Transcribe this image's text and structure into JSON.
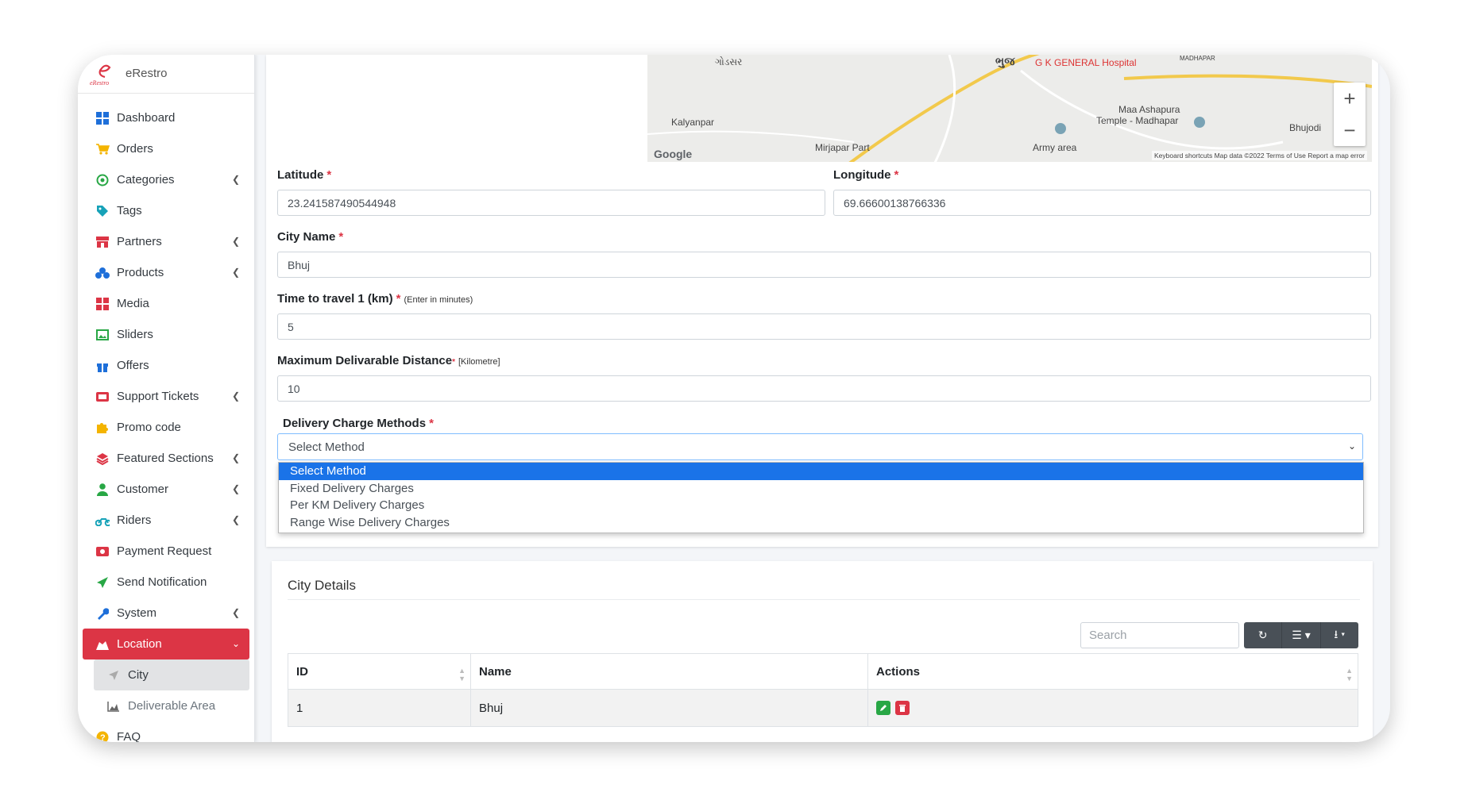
{
  "brand": {
    "name": "eRestro",
    "logo_text": "eRestro"
  },
  "sidebar": {
    "items": [
      {
        "label": "Dashboard",
        "icon": "dashboard-icon",
        "chevron": false
      },
      {
        "label": "Orders",
        "icon": "cart-icon",
        "chevron": false
      },
      {
        "label": "Categories",
        "icon": "categories-icon",
        "chevron": true
      },
      {
        "label": "Tags",
        "icon": "tag-icon",
        "chevron": false
      },
      {
        "label": "Partners",
        "icon": "store-icon",
        "chevron": true
      },
      {
        "label": "Products",
        "icon": "products-icon",
        "chevron": true
      },
      {
        "label": "Media",
        "icon": "media-icon",
        "chevron": false
      },
      {
        "label": "Sliders",
        "icon": "slider-icon",
        "chevron": false
      },
      {
        "label": "Offers",
        "icon": "gift-icon",
        "chevron": false
      },
      {
        "label": "Support Tickets",
        "icon": "ticket-icon",
        "chevron": true
      },
      {
        "label": "Promo code",
        "icon": "puzzle-icon",
        "chevron": false
      },
      {
        "label": "Featured Sections",
        "icon": "layers-icon",
        "chevron": true
      },
      {
        "label": "Customer",
        "icon": "user-icon",
        "chevron": true
      },
      {
        "label": "Riders",
        "icon": "motorcycle-icon",
        "chevron": true
      },
      {
        "label": "Payment Request",
        "icon": "money-icon",
        "chevron": false
      },
      {
        "label": "Send Notification",
        "icon": "paper-plane-icon",
        "chevron": false
      },
      {
        "label": "System",
        "icon": "wrench-icon",
        "chevron": true
      }
    ],
    "location": {
      "label": "Location"
    },
    "city": {
      "label": "City"
    },
    "deliverable": {
      "label": "Deliverable Area"
    },
    "faq": {
      "label": "FAQ"
    }
  },
  "map": {
    "labels": [
      "ભુજ",
      "G K GENERAL Hospital",
      "Kalyanpar",
      "Mirjapar Part",
      "Maa Ashapura",
      "Temple - Madhapar",
      "Army area",
      "Bhujodi",
      "MADHAPAR",
      "ગોડસર"
    ],
    "footer": "Keyboard shortcuts   Map data ©2022   Terms of Use   Report a map error",
    "google": "Google"
  },
  "form": {
    "latitude_label": "Latitude",
    "latitude_value": "23.241587490544948",
    "longitude_label": "Longitude",
    "longitude_value": "69.66600138766336",
    "city_label": "City Name",
    "city_value": "Bhuj",
    "time_label": "Time to travel 1 (km)",
    "time_hint": "(Enter in minutes)",
    "time_value": "5",
    "distance_label": "Maximum Delivarable Distance",
    "distance_hint": "[Kilometre]",
    "distance_value": "10",
    "method_label": "Delivery Charge Methods",
    "method_selected": "Select Method",
    "method_options": [
      "Select Method",
      "Fixed Delivery Charges",
      "Per KM Delivery Charges",
      "Range Wise Delivery Charges"
    ],
    "required_mark": "*"
  },
  "city_details": {
    "title": "City Details",
    "search_placeholder": "Search",
    "columns": [
      "ID",
      "Name",
      "Actions"
    ],
    "rows": [
      {
        "id": "1",
        "name": "Bhuj"
      }
    ]
  },
  "colors": {
    "accent": "#dc3545",
    "edit": "#28a745",
    "select_highlight": "#1a73e8"
  }
}
